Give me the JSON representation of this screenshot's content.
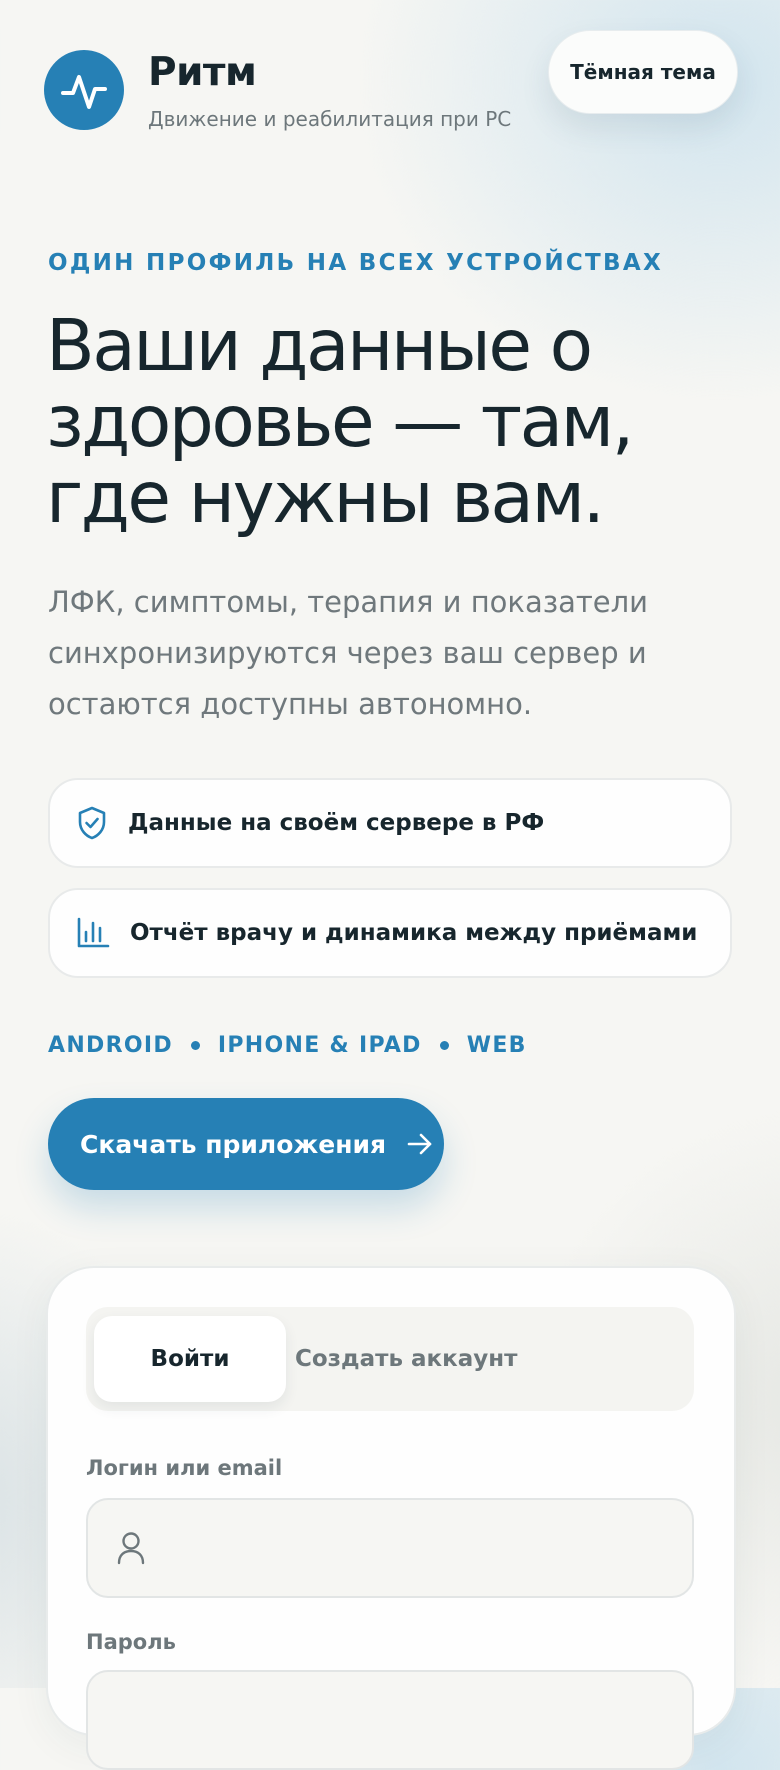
{
  "header": {
    "brand_name": "Ритм",
    "brand_subtitle": "Движение и реабилитация при РС",
    "theme_toggle_label": "Тёмная тема",
    "logo_icon": "pulse-icon"
  },
  "hero": {
    "eyebrow": "ОДИН ПРОФИЛЬ НА ВСЕХ УСТРОЙСТВАХ",
    "headline_lines": [
      "Ваши данные о",
      "здоровье — там,",
      "где нужны вам."
    ],
    "lead": "ЛФК, симптомы, терапия и показатели синхронизируются через ваш сервер и остаются доступны автономно."
  },
  "features": [
    {
      "icon": "shield-check-icon",
      "label": "Данные на своём сервере в РФ"
    },
    {
      "icon": "bar-chart-icon",
      "label": "Отчёт врачу и динамика между приёмами"
    }
  ],
  "platforms": [
    "ANDROID",
    "IPHONE & IPAD",
    "WEB"
  ],
  "download_button": {
    "label": "Скачать приложения",
    "icon": "arrow-right-icon"
  },
  "auth": {
    "tabs": [
      {
        "label": "Войти",
        "active": true
      },
      {
        "label": "Создать аккаунт",
        "active": false
      }
    ],
    "login_label": "Логин или email",
    "login_value": "",
    "login_icon": "user-icon",
    "password_label": "Пароль",
    "password_value": ""
  },
  "colors": {
    "accent": "#2680b5",
    "text": "#17262d",
    "muted": "#6d777b",
    "background": "#f6f6f3"
  }
}
